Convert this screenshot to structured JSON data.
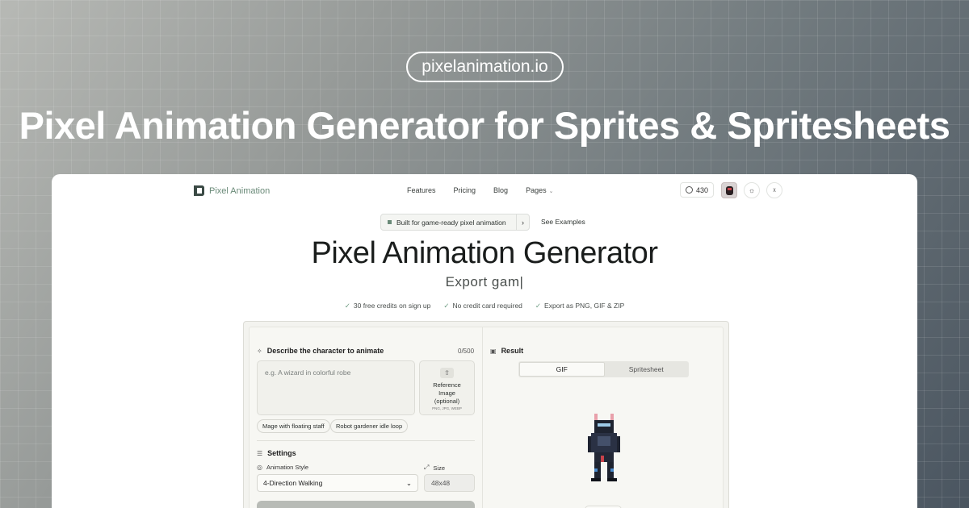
{
  "domain_pill": "pixelanimation.io",
  "hero_title": "Pixel Animation Generator for Sprites & Spritesheets",
  "nav": {
    "brand": "Pixel Animation",
    "links": [
      "Features",
      "Pricing",
      "Blog",
      "Pages"
    ],
    "credits": "430"
  },
  "hero": {
    "badge": "Built for game-ready pixel animation",
    "see_examples": "See Examples",
    "title": "Pixel Animation Generator",
    "typing": "Export gam|",
    "checks": [
      "30 free credits on sign up",
      "No credit card required",
      "Export as PNG, GIF & ZIP"
    ]
  },
  "tool": {
    "describe_label": "Describe the character to animate",
    "counter": "0/500",
    "placeholder": "e.g. A wizard in colorful robe",
    "reference": [
      "Reference",
      "Image",
      "(optional)"
    ],
    "reference_formats": "PNG, JPG, WEBP",
    "chips": [
      "Mage with floating staff",
      "Robot gardener idle loop"
    ],
    "settings_label": "Settings",
    "style_label": "Animation Style",
    "style_value": "4-Direction Walking",
    "size_label": "Size",
    "size_value": "48x48",
    "result_label": "Result",
    "tabs": [
      "GIF",
      "Spritesheet"
    ]
  },
  "colors": {
    "accent": "#6a8a78",
    "card": "#ffffff"
  }
}
